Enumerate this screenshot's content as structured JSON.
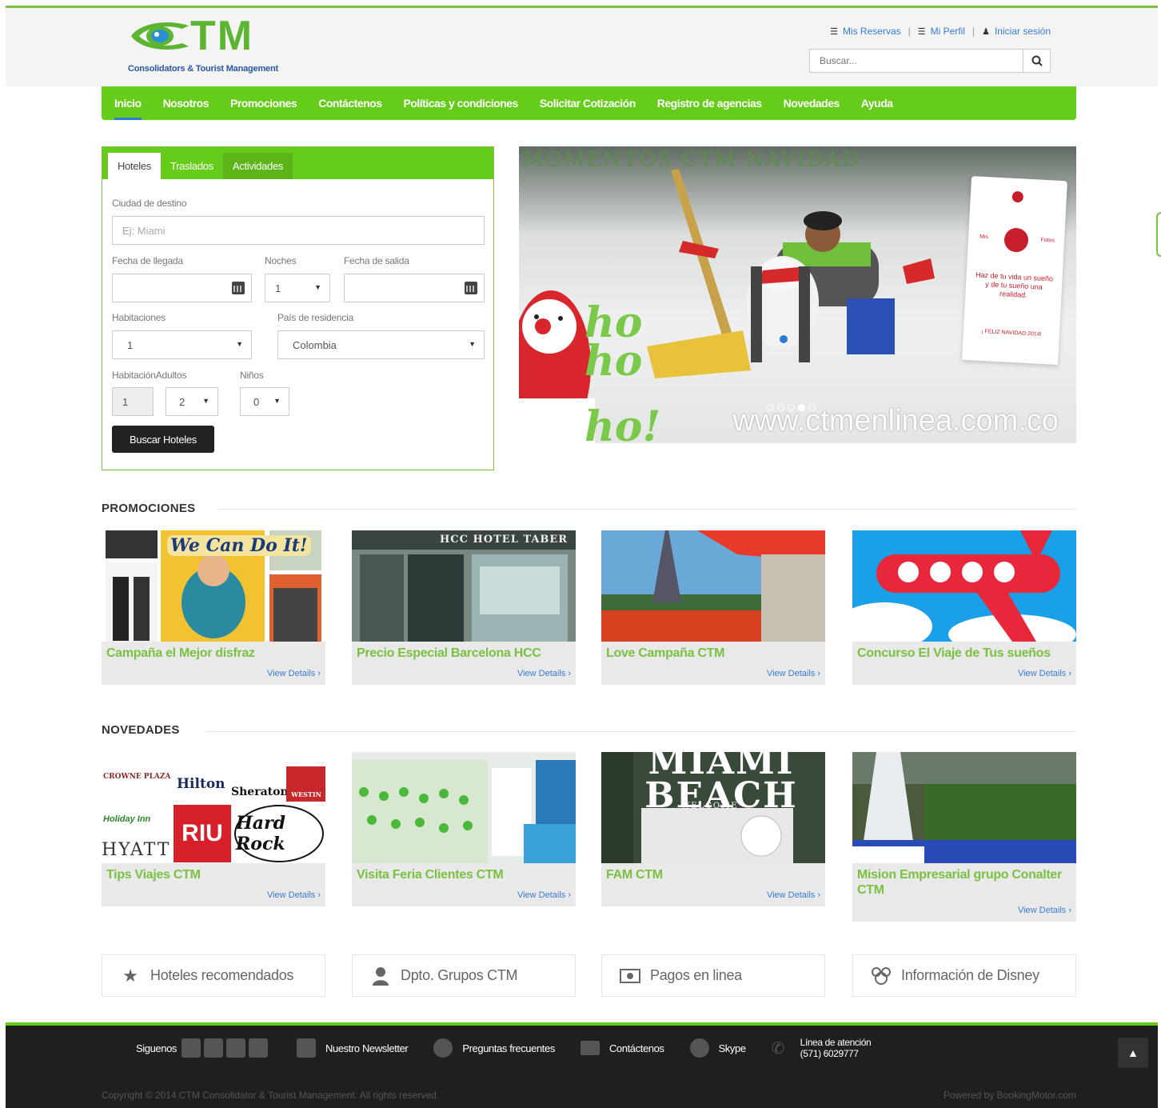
{
  "brand": {
    "logo_text": "TM",
    "tagline": "Consolidators & Tourist Management",
    "green": "#66cc1a",
    "blue": "#2a56a8"
  },
  "toplinks": [
    {
      "label": "Mis Reservas",
      "icon": "list-icon"
    },
    {
      "label": "Mi Perfil",
      "icon": "list-icon"
    },
    {
      "label": "Iniciar sesión",
      "icon": "user-icon"
    }
  ],
  "search": {
    "placeholder": "Buscar..."
  },
  "nav": [
    "Inicio",
    "Nosotros",
    "Promociones",
    "Contáctenos",
    "Políticas y condiciones",
    "Solicitar Cotización",
    "Registro de agencias",
    "Novedades",
    "Ayuda"
  ],
  "booking": {
    "tabs": [
      "Hoteles",
      "Traslados",
      "Actividades"
    ],
    "destino_label": "Ciudad de destino",
    "destino_placeholder": "Ej: Miami",
    "llegada_label": "Fecha de llegada",
    "noches_label": "Noches",
    "noches_value": "1",
    "salida_label": "Fecha de salida",
    "habitaciones_label": "Habitaciones",
    "habitaciones_value": "1",
    "pais_label": "País de residencia",
    "pais_value": "Colombia",
    "habitacion_label": "Habitación",
    "adultos_label": "Adultos",
    "ninos_label": "Niños",
    "habitacion_value": "1",
    "adultos_value": "2",
    "ninos_value": "0",
    "submit": "Buscar Hoteles"
  },
  "banner": {
    "title": "MOMENTOS CTM NAVIDAD",
    "url": "www.ctmenlinea.com.co",
    "ho": [
      "ho",
      "ho",
      "ho!"
    ],
    "tag_text": "Haz de tu vida un sueño y de tu sueño una realidad.",
    "tag_small": "¡ FELIZ NAVIDAD 2014!",
    "tag_mini_left": "Mis",
    "tag_mini_right": "Fotos"
  },
  "promociones": {
    "title": "PROMOCIONES",
    "cards": [
      {
        "title": "Campaña el Mejor disfraz",
        "link": "View Details ›",
        "image_text": "We Can Do It!"
      },
      {
        "title": "Precio Especial Barcelona HCC",
        "link": "View Details ›",
        "image_text": "HCC HOTEL TABER"
      },
      {
        "title": "Love Campaña CTM",
        "link": "View Details ›"
      },
      {
        "title": "Concurso El Viaje de Tus sueños",
        "link": "View Details ›"
      }
    ]
  },
  "novedades": {
    "title": "NOVEDADES",
    "cards": [
      {
        "title": "Tips Viajes CTM",
        "link": "View Details ›"
      },
      {
        "title": "Visita Feria Clientes CTM",
        "link": "View Details ›"
      },
      {
        "title": "FAM CTM",
        "link": "View Details ›",
        "image_text": "MIAMI BEACH",
        "image_sub": "WELCOME"
      },
      {
        "title": "Mision Empresarial grupo Conalter CTM",
        "link": "View Details ›"
      }
    ],
    "hotel_logos": [
      "CROWNE PLAZA",
      "Hilton",
      "Sheraton",
      "WESTIN",
      "Holiday Inn",
      "RIU",
      "Hard Rock",
      "HYATT"
    ]
  },
  "features": [
    {
      "label": "Hoteles recomendados",
      "icon": "star-icon"
    },
    {
      "label": "Dpto. Grupos CTM",
      "icon": "user-icon"
    },
    {
      "label": "Pagos en linea",
      "icon": "money-icon"
    },
    {
      "label": "Información de Disney",
      "icon": "disney-icon"
    }
  ],
  "footer": {
    "siguenos": "Siguenos",
    "newsletter": "Nuestro Newsletter",
    "faq": "Preguntas frecuentes",
    "contact": "Contáctenos",
    "skype": "Skype",
    "linea_label": "Línea de atención",
    "linea_phone": "(571) 6029777",
    "copyright": "Copyright © 2014 CTM Consolidator & Tourist Management. All rights reserved.",
    "powered": "Powered by BookingMotor.com"
  }
}
